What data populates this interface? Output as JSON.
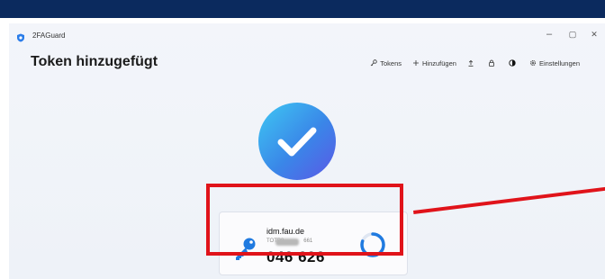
{
  "window": {
    "app_name": "2FAGuard",
    "controls": {
      "minimize": "–",
      "maximize": "▢",
      "close": "✕"
    }
  },
  "page": {
    "title": "Token hinzugefügt"
  },
  "toolbar": {
    "tokens_label": "Tokens",
    "add_label": "Hinzufügen",
    "settings_label": "Einstellungen"
  },
  "token": {
    "issuer": "idm.fau.de",
    "account": "TOTP8",
    "account_suffix": "661",
    "code": "046 626",
    "timer_remaining_fraction": 0.8
  },
  "colors": {
    "accent": "#1f7ae0",
    "highlight": "#e0131a",
    "top_bar": "#0b2a5e"
  }
}
